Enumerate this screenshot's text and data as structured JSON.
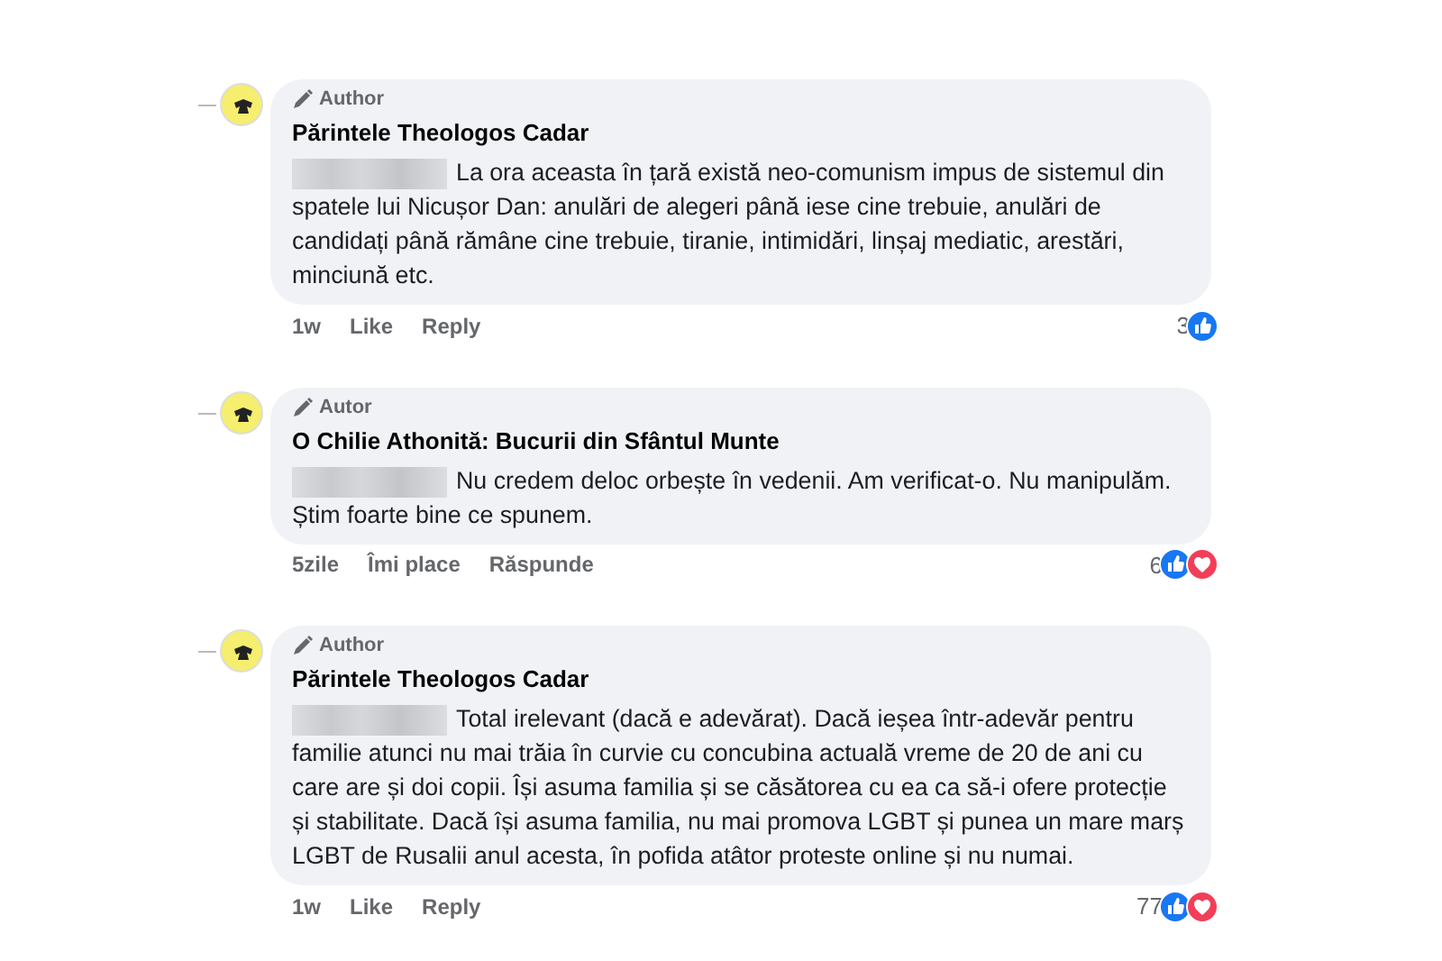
{
  "comments": [
    {
      "badge": "Author",
      "author": "Părintele Theologos Cadar",
      "text": "La ora aceasta în țară există neo-comunism impus de sistemul din spatele lui Nicușor Dan: anulări de alegeri până iese cine trebuie, anulări de candidați până rămâne cine trebuie, tiranie, intimidări, linșaj mediatic, arestări, minciună etc.",
      "time": "1w",
      "like": "Like",
      "reply": "Reply",
      "reaction_count": "3",
      "reactions": [
        {
          "kind": "like"
        }
      ]
    },
    {
      "badge": "Autor",
      "author": "O Chilie Athonită: Bucurii din Sfântul Munte",
      "text": "Nu credem deloc orbește în vedenii. Am verificat-o. Nu manipulăm. Știm foarte bine ce spunem.",
      "time": "5zile",
      "like": "Îmi place",
      "reply": "Răspunde",
      "reaction_count": "6",
      "reactions": [
        {
          "kind": "like"
        },
        {
          "kind": "love"
        }
      ]
    },
    {
      "badge": "Author",
      "author": "Părintele Theologos Cadar",
      "text": "Total irelevant (dacă e adevărat). Dacă ieșea într-adevăr pentru familie atunci nu mai trăia în curvie cu concubina actuală vreme de 20 de ani cu care are și doi copii. Își asuma familia și se căsătorea cu ea ca să-i ofere protecție și stabilitate. Dacă își asuma familia, nu mai promova LGBT și punea un mare marș LGBT de Rusalii anul acesta, în pofida atâtor proteste online și nu numai.",
      "time": "1w",
      "like": "Like",
      "reply": "Reply",
      "reaction_count": "77",
      "reactions": [
        {
          "kind": "like"
        },
        {
          "kind": "love"
        }
      ]
    }
  ]
}
